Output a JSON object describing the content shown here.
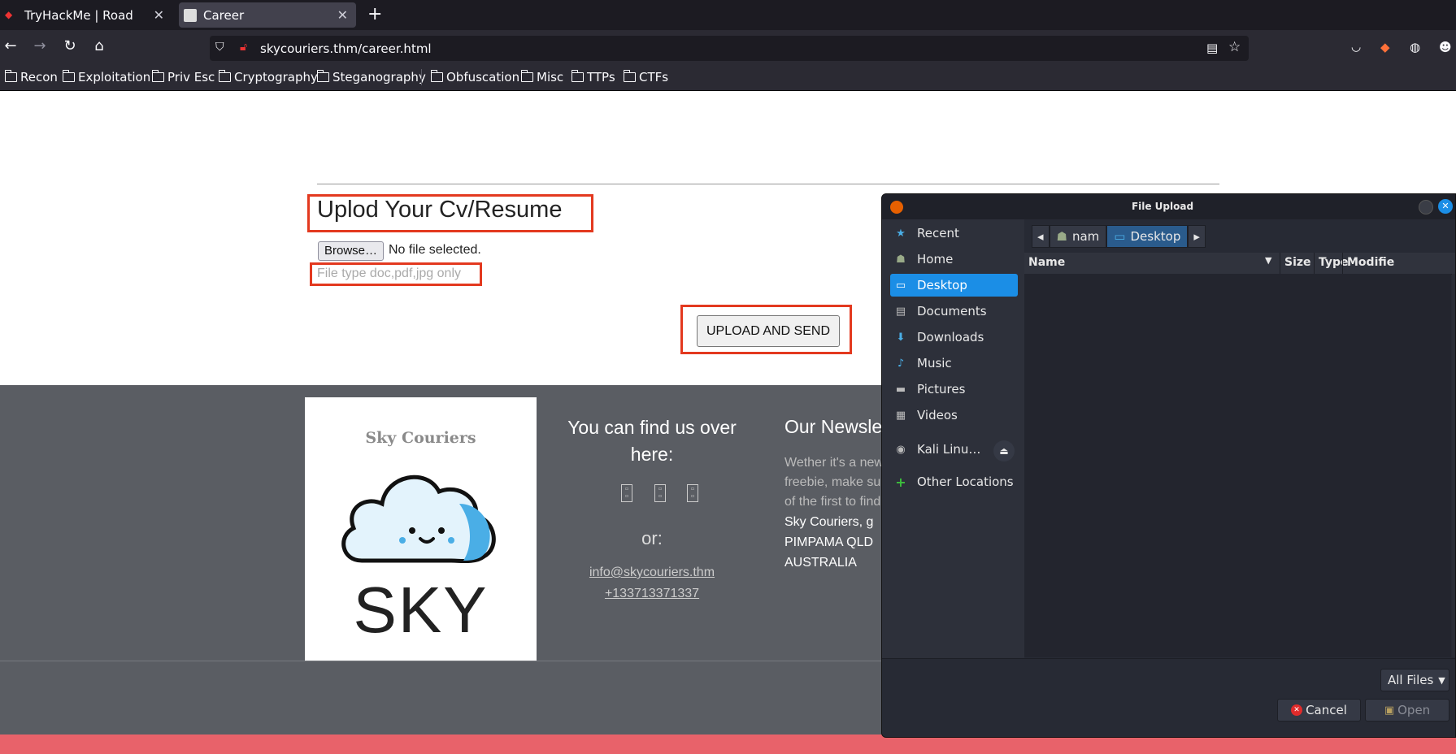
{
  "browser": {
    "tabs": [
      {
        "label": "TryHackMe | Road"
      },
      {
        "label": "Career"
      }
    ],
    "url": "skycouriers.thm/career.html",
    "bookmarks": [
      "Recon",
      "Exploitation",
      "Priv Esc",
      "Cryptography",
      "Steganography",
      "Obfuscation",
      "Misc",
      "TTPs",
      "CTFs"
    ]
  },
  "page": {
    "heading": "Uplod Your Cv/Resume",
    "browse_label": "Browse…",
    "file_status": "No file selected.",
    "file_type_hint": "File type doc,pdf,jpg only",
    "upload_button": "UPLOAD AND SEND",
    "colors": {
      "highlight": "#e3391f",
      "footer": "#5a5d63",
      "pinkbar": "#e8626a"
    }
  },
  "footer": {
    "logo_title": "Sky Couriers",
    "logo_text": "SKY",
    "find_us": "You can find us over here:",
    "or": "or:",
    "email": "info@skycouriers.thm",
    "phone": "+133713371337",
    "newsletter_title": "Our Newsle",
    "newsletter_lines": [
      "Wether it's a new",
      "freebie, make su",
      "of the first to find"
    ],
    "address_lines": [
      "Sky Couriers, g",
      "PIMPAMA QLD",
      "AUSTRALIA"
    ]
  },
  "dialog": {
    "title": "File Upload",
    "sidebar": [
      {
        "label": "Recent",
        "icon": "star-icon"
      },
      {
        "label": "Home",
        "icon": "home-icon"
      },
      {
        "label": "Desktop",
        "icon": "desktop-icon",
        "active": true
      },
      {
        "label": "Documents",
        "icon": "documents-icon"
      },
      {
        "label": "Downloads",
        "icon": "download-icon"
      },
      {
        "label": "Music",
        "icon": "music-icon"
      },
      {
        "label": "Pictures",
        "icon": "pictures-icon"
      },
      {
        "label": "Videos",
        "icon": "videos-icon"
      },
      {
        "label": "Kali Linu…",
        "icon": "disc-icon"
      },
      {
        "label": "Other Locations",
        "icon": "plus-icon"
      }
    ],
    "path": [
      "nam",
      "Desktop"
    ],
    "columns": [
      "Name",
      "Size",
      "Type",
      "Modifie"
    ],
    "filter": "All Files",
    "cancel": "Cancel",
    "open": "Open"
  }
}
